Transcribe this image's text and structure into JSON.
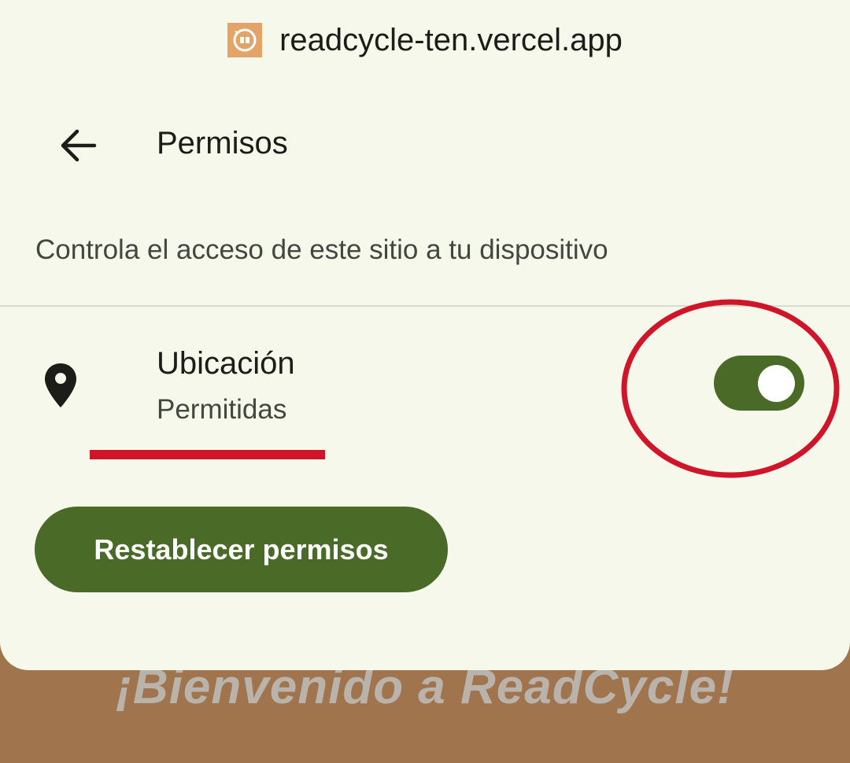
{
  "background": {
    "welcome_text": "¡Bienvenido a ReadCycle!"
  },
  "site": {
    "favicon_icon": "readcycle-book-icon",
    "url": "readcycle-ten.vercel.app"
  },
  "header": {
    "back_icon": "arrow-back-icon",
    "title": "Permisos"
  },
  "description": "Controla el acceso de este sitio a tu dispositivo",
  "permissions": [
    {
      "icon": "location-pin-icon",
      "name": "Ubicación",
      "status": "Permitidas",
      "enabled": true
    }
  ],
  "reset_button": {
    "label": "Restablecer permisos"
  },
  "colors": {
    "accent": "#4a6a28",
    "sheet_bg": "#f5f8ea",
    "page_bg": "#a0744c",
    "annotation": "#d0142a",
    "favicon_bg": "#e2a468"
  }
}
